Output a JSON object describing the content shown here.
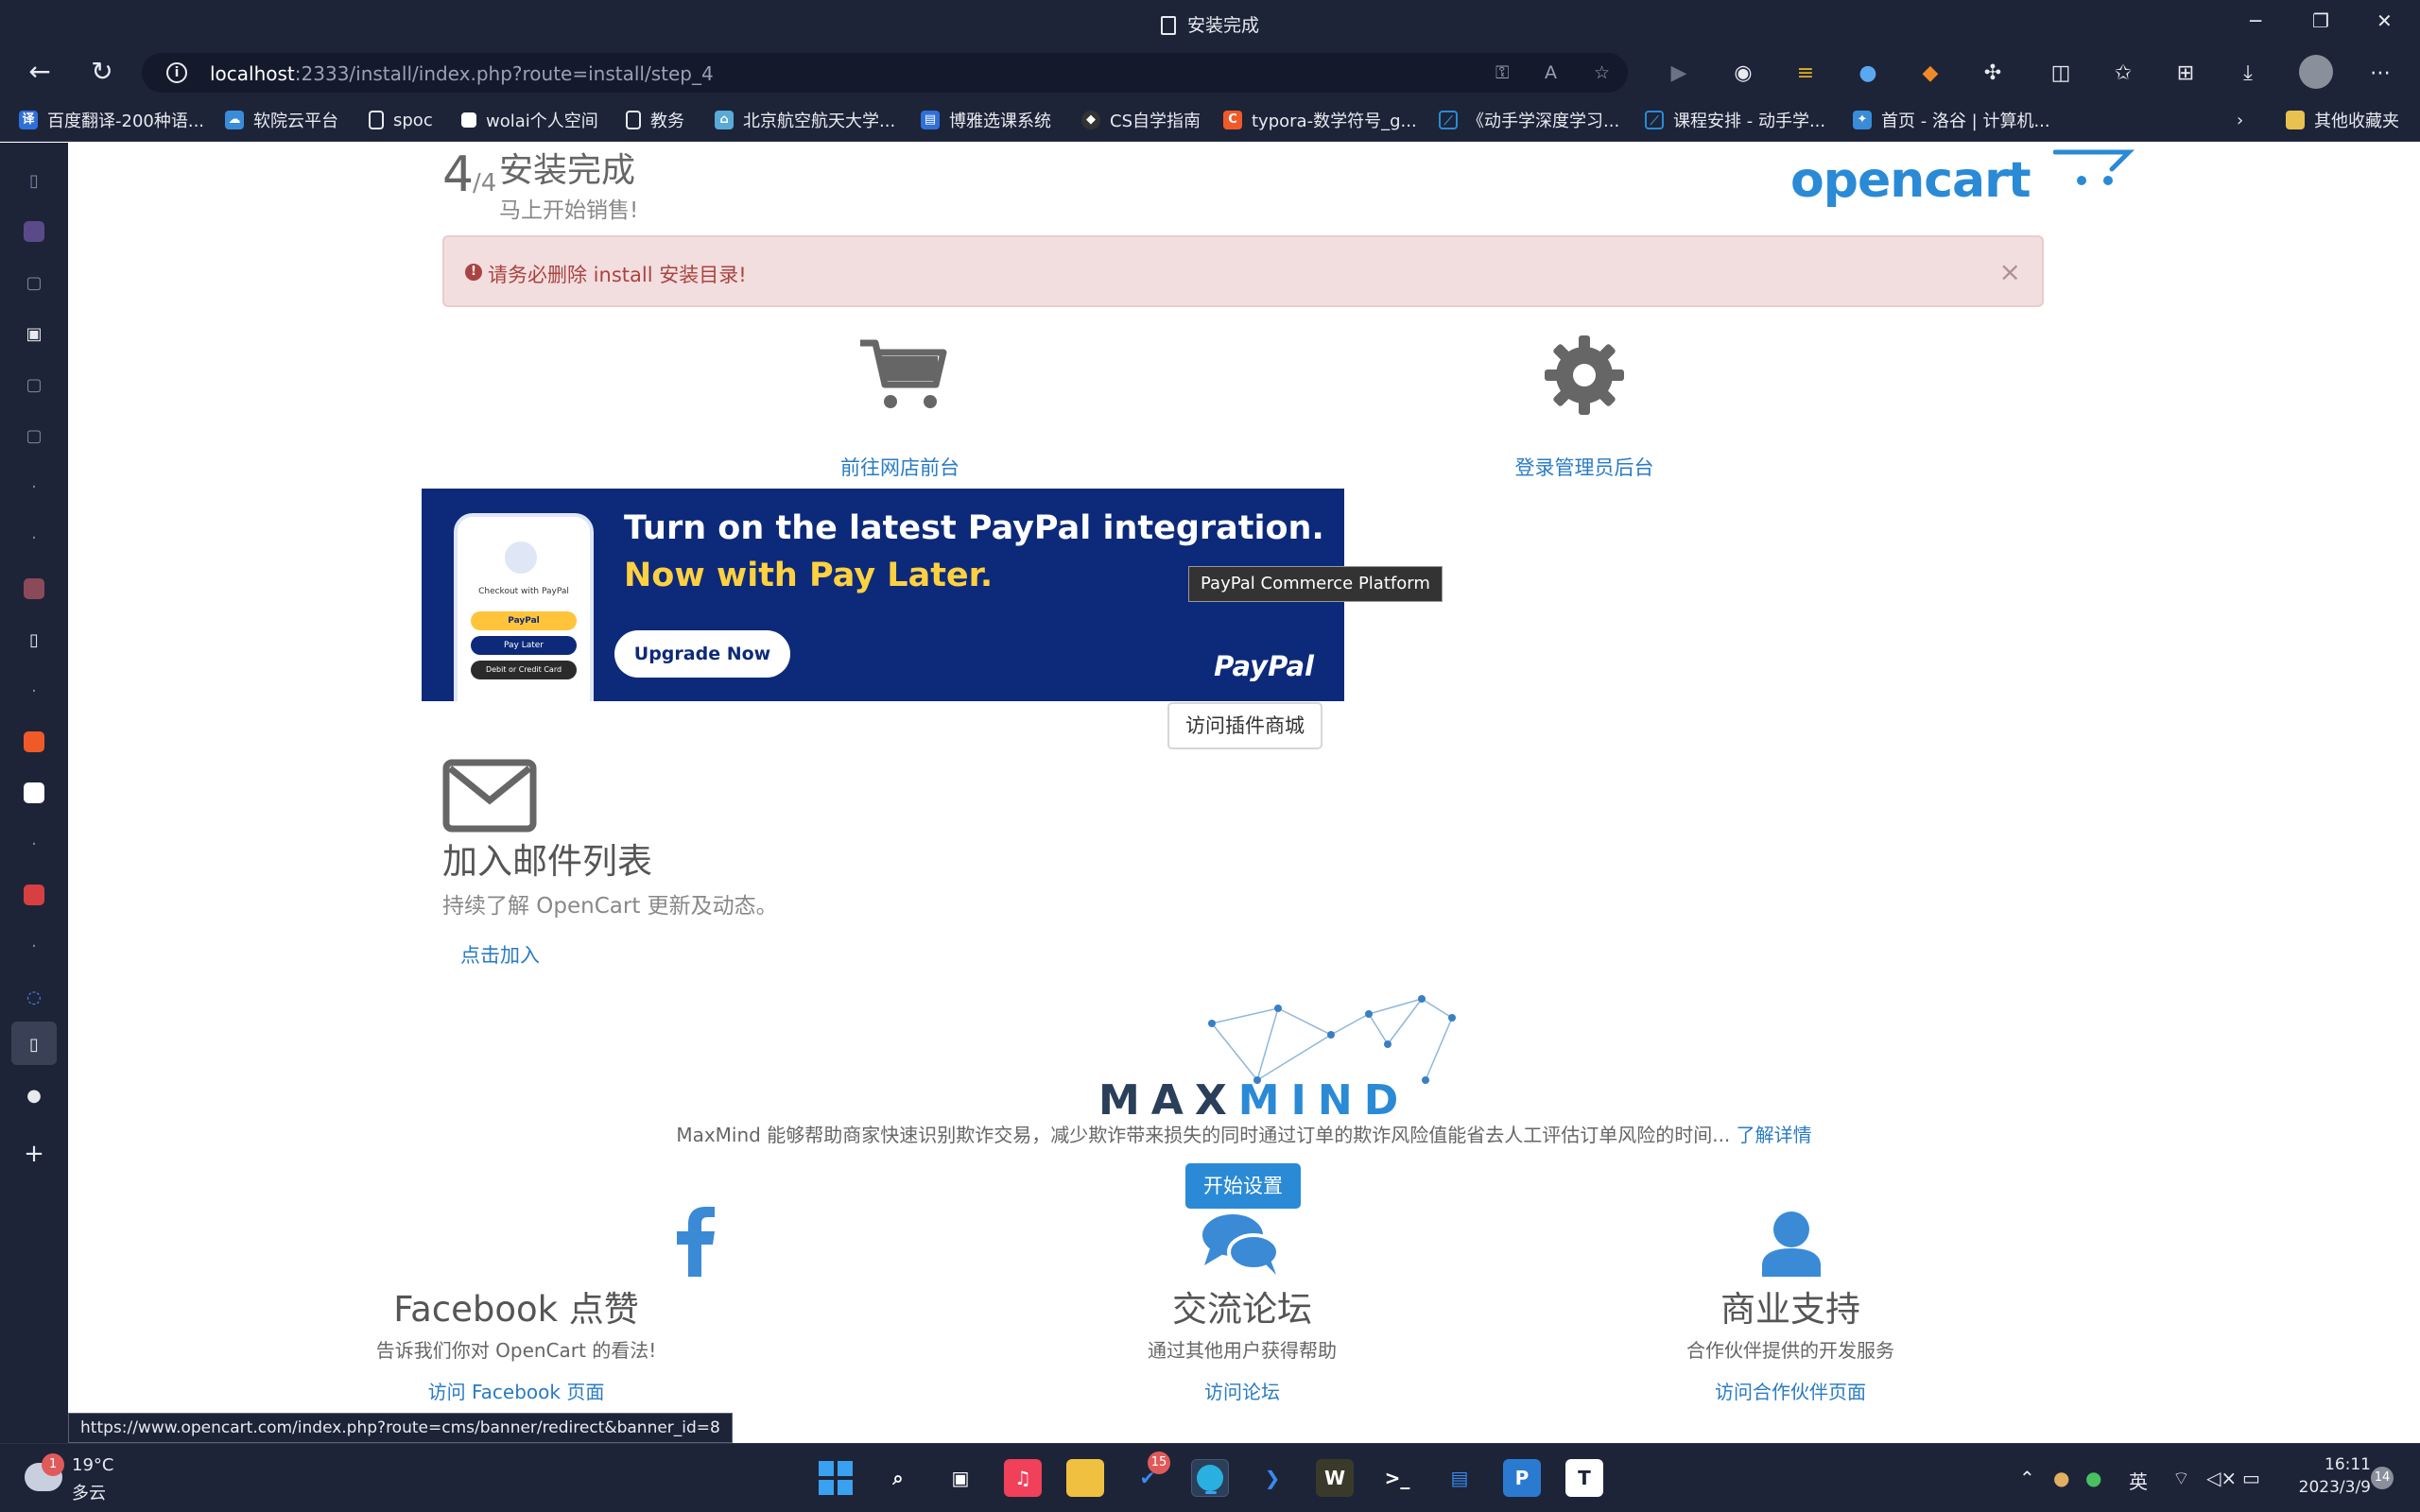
{
  "window": {
    "title": "安装完成"
  },
  "address_bar": {
    "host": "localhost",
    "path": ":2333/install/index.php?route=install/step_4"
  },
  "bookmarks": [
    {
      "label": "百度翻译-200种语...",
      "icon": "translate-icon",
      "color": "#2f6fd8"
    },
    {
      "label": "软院云平台",
      "icon": "cloud-icon",
      "color": "#3a8bd8"
    },
    {
      "label": "spoc",
      "icon": "page-icon",
      "color": "#1d2438"
    },
    {
      "label": "wolai个人空间",
      "icon": "wolai-icon",
      "color": "#ffffff"
    },
    {
      "label": "教务",
      "icon": "page-icon",
      "color": "#1d2438"
    },
    {
      "label": "北京航空航天大学...",
      "icon": "buaa-icon",
      "color": "#5aa9d6"
    },
    {
      "label": "博雅选课系统",
      "icon": "book-icon",
      "color": "#2f6fd8"
    },
    {
      "label": "CS自学指南",
      "icon": "cs-icon",
      "color": "#333333"
    },
    {
      "label": "typora-数学符号_g...",
      "icon": "c-icon",
      "color": "#f05a28"
    },
    {
      "label": "《动手学深度学习...",
      "icon": "d2l-icon",
      "color": "#2a8ad6"
    },
    {
      "label": "课程安排 - 动手学...",
      "icon": "d2l-icon",
      "color": "#2a8ad6"
    },
    {
      "label": "首页 - 洛谷 | 计算机...",
      "icon": "luogu-icon",
      "color": "#3a8bd8"
    }
  ],
  "bookmarks_other": "其他收藏夹",
  "header": {
    "step_num": "4",
    "step_den": "/4",
    "title": "安装完成",
    "subtitle": "马上开始销售!",
    "logo": "opencart"
  },
  "alert": {
    "text": "请务必删除 install 安装目录!",
    "close": "×"
  },
  "actions": {
    "storefront": "前往网店前台",
    "admin": "登录管理员后台"
  },
  "banner": {
    "line1": "Turn on the latest PayPal integration.",
    "line2": "Now with Pay Later.",
    "button": "Upgrade Now",
    "brand": "PayPal",
    "phone_caption": "Checkout with PayPal",
    "phone_btn1": "PayPal",
    "phone_btn2": "Pay Later",
    "phone_btn3": "Debit or Credit Card"
  },
  "tooltip": "PayPal Commerce Platform",
  "plugin_button": "访问插件商城",
  "mailing": {
    "title": "加入邮件列表",
    "subtitle": "持续了解 OpenCart 更新及动态。",
    "join": "点击加入"
  },
  "maxmind": {
    "logo_a": "MAX",
    "logo_b": "MIND",
    "desc": "MaxMind 能够帮助商家快速识别欺诈交易，减少欺诈带来损失的同时通过订单的欺诈风险值能省去人工评估订单风险的时间...",
    "more": "了解详情",
    "setup": "开始设置"
  },
  "columns": [
    {
      "title": "Facebook 点赞",
      "desc": "告诉我们你对 OpenCart 的看法!",
      "link": "访问 Facebook 页面",
      "icon": "facebook-icon"
    },
    {
      "title": "交流论坛",
      "desc": "通过其他用户获得帮助",
      "link": "访问论坛",
      "icon": "chat-icon"
    },
    {
      "title": "商业支持",
      "desc": "合作伙伴提供的开发服务",
      "link": "访问合作伙伴页面",
      "icon": "user-icon"
    }
  ],
  "status_url": "https://www.opencart.com/index.php?route=cms/banner/redirect&banner_id=8",
  "taskbar": {
    "weather_temp": "19°C",
    "weather_desc": "多云",
    "weather_badge": "1",
    "todo_badge": "15",
    "ime": "英",
    "time": "16:11",
    "date": "2023/3/9",
    "notif_badge": "14"
  },
  "colors": {
    "chrome": "#1d2438",
    "link": "#2a7bc4",
    "accent": "#2a8ad6",
    "alert_text": "#a94442",
    "alert_bg": "#f2dede",
    "banner_bg": "#0d2a7a",
    "banner_yellow": "#ffd140"
  }
}
